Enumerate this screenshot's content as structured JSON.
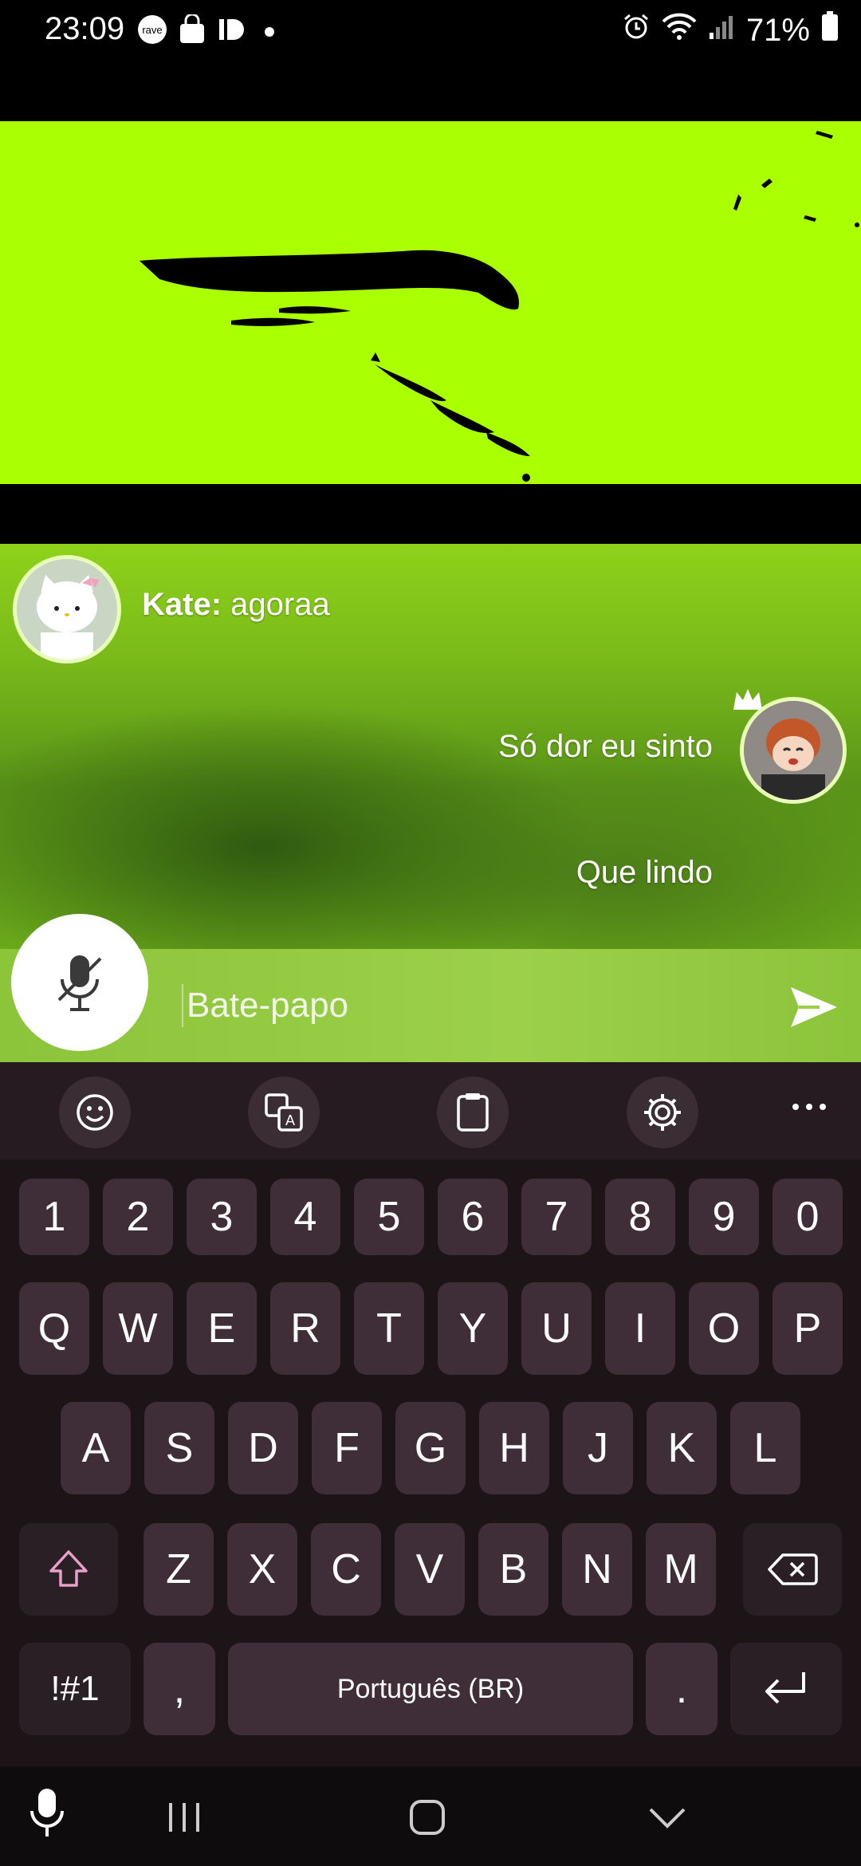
{
  "status_bar": {
    "time": "23:09",
    "left_icons": [
      "rave-icon",
      "shopping-bag-icon",
      "app-notification-icon",
      "dot-icon"
    ],
    "right_icons": [
      "alarm-icon",
      "wifi-icon",
      "signal-icon",
      "battery-icon"
    ],
    "battery": "71%"
  },
  "chat": {
    "messages": [
      {
        "author": "Kate:",
        "text": "agoraa",
        "side": "left"
      },
      {
        "author": "",
        "text": "Só dor eu sinto",
        "side": "right"
      },
      {
        "author": "",
        "text": "Que lindo",
        "side": "right"
      }
    ]
  },
  "input": {
    "placeholder": "Bate-papo"
  },
  "keyboard": {
    "toolbar": [
      "emoji-icon",
      "translate-icon",
      "clipboard-icon",
      "settings-icon",
      "more-icon"
    ],
    "row_numbers": [
      "1",
      "2",
      "3",
      "4",
      "5",
      "6",
      "7",
      "8",
      "9",
      "0"
    ],
    "row_q": [
      "Q",
      "W",
      "E",
      "R",
      "T",
      "Y",
      "U",
      "I",
      "O",
      "P"
    ],
    "row_a": [
      "A",
      "S",
      "D",
      "F",
      "G",
      "H",
      "J",
      "K",
      "L"
    ],
    "row_z": [
      "Z",
      "X",
      "C",
      "V",
      "B",
      "N",
      "M"
    ],
    "symbols_key": "!#1",
    "comma_key": ",",
    "space_label": "Português (BR)",
    "period_key": "."
  },
  "colors": {
    "video_green": "#aaff00",
    "key_bg": "#3f2e38",
    "keyboard_bg": "#1d1417",
    "shift_pink": "#e8a0c8"
  }
}
